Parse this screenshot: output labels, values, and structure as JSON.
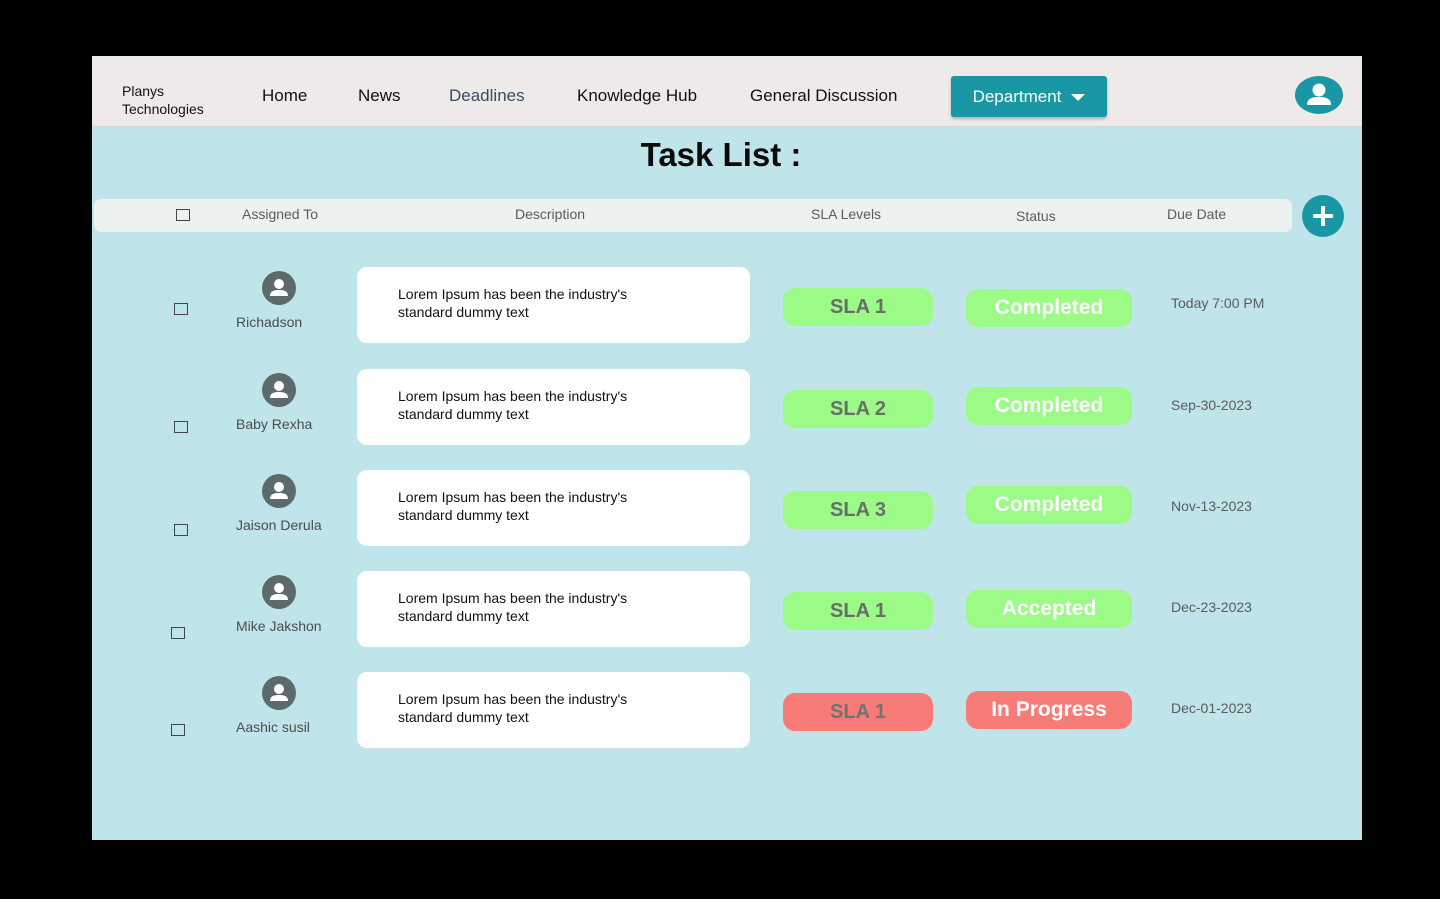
{
  "brand": {
    "name": "Planys Technologies"
  },
  "nav": {
    "items": [
      {
        "label": "Home"
      },
      {
        "label": "News"
      },
      {
        "label": "Deadlines",
        "active": true
      },
      {
        "label": "Knowledge Hub"
      },
      {
        "label": "General Discussion"
      }
    ],
    "department_label": "Department",
    "profile_icon": "user-icon"
  },
  "page": {
    "title": "Task List :"
  },
  "table": {
    "headers": {
      "assigned_to": "Assigned To",
      "description": "Description",
      "sla_levels": "SLA Levels",
      "status": "Status",
      "due_date": "Due Date"
    },
    "rows": [
      {
        "assignee": "Richadson",
        "description": "Lorem Ipsum has been the industry's standard dummy text",
        "sla": "SLA 1",
        "status": "Completed",
        "due": "Today 7:00 PM",
        "tone": "green"
      },
      {
        "assignee": "Baby Rexha",
        "description": "Lorem Ipsum has been the industry's standard dummy text",
        "sla": "SLA 2",
        "status": "Completed",
        "due": "Sep-30-2023",
        "tone": "green"
      },
      {
        "assignee": "Jaison Derula",
        "description": "Lorem Ipsum has been the industry's standard dummy text",
        "sla": "SLA 3",
        "status": "Completed",
        "due": "Nov-13-2023",
        "tone": "green"
      },
      {
        "assignee": "Mike Jakshon",
        "description": "Lorem Ipsum has been the industry's standard dummy text",
        "sla": "SLA 1",
        "status": "Accepted",
        "due": "Dec-23-2023",
        "tone": "green"
      },
      {
        "assignee": "Aashic susil",
        "description": "Lorem Ipsum has been the industry's standard dummy text",
        "sla": "SLA 1",
        "status": "In Progress",
        "due": "Dec-01-2023",
        "tone": "red"
      }
    ]
  },
  "colors": {
    "accent": "#1a97a4",
    "background": "#bfe5ea",
    "status_green": "#9cfa86",
    "status_red": "#f77c78"
  }
}
